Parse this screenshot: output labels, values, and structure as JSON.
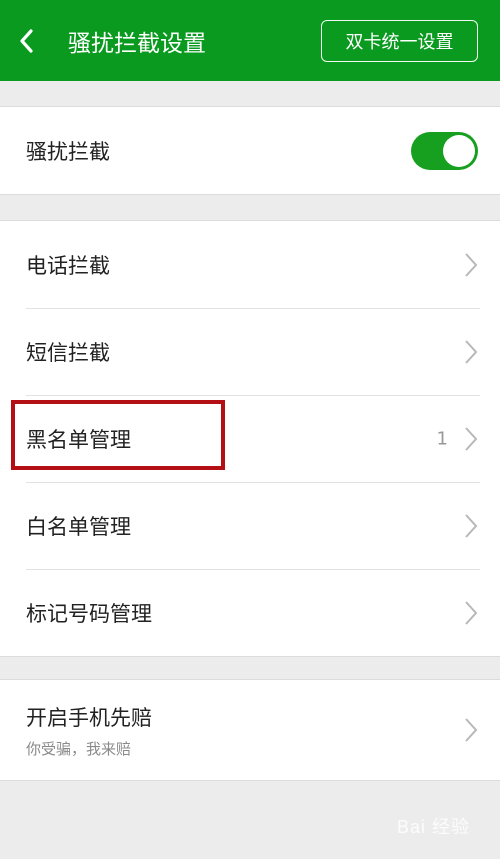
{
  "header": {
    "title": "骚扰拦截设置",
    "dual_sim_button": "双卡统一设置",
    "back_icon": "chevron-left-icon"
  },
  "toggle_group": {
    "label": "骚扰拦截",
    "toggle_on": true,
    "toggle_color": "#17a01f"
  },
  "menu": {
    "items": [
      {
        "label": "电话拦截",
        "count": ""
      },
      {
        "label": "短信拦截",
        "count": ""
      },
      {
        "label": "黑名单管理",
        "count": "1"
      },
      {
        "label": "白名单管理",
        "count": ""
      },
      {
        "label": "标记号码管理",
        "count": ""
      }
    ]
  },
  "compensation": {
    "title": "开启手机先赔",
    "subtitle": "你受骗，我来赔"
  },
  "watermark": "Bai 经验",
  "colors": {
    "header_bg": "#0a9a1f",
    "highlight": "#b30f14"
  }
}
